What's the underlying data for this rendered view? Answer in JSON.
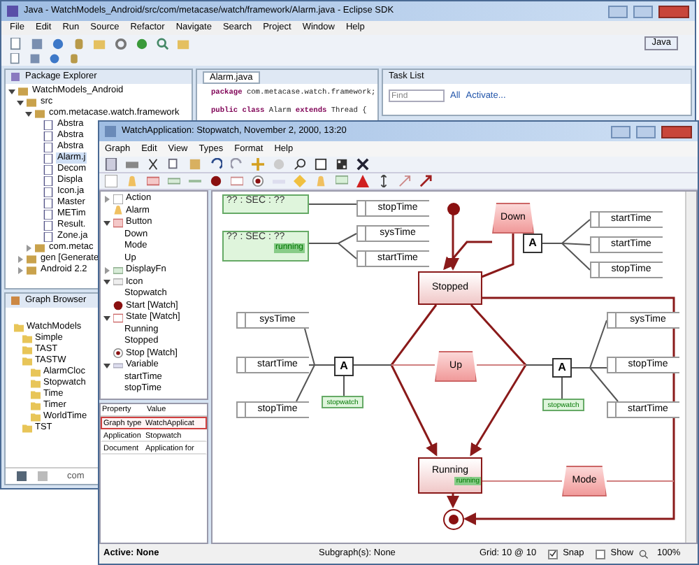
{
  "back_window": {
    "title": "Java - WatchModels_Android/src/com/metacase/watch/framework/Alarm.java - Eclipse SDK",
    "menu": [
      "File",
      "Edit",
      "Run",
      "Source",
      "Refactor",
      "Navigate",
      "Search",
      "Project",
      "Window",
      "Help"
    ],
    "perspective": "Java",
    "package_explorer": {
      "title": "Package Explorer",
      "items": [
        {
          "label": "WatchModels_Android",
          "expanded": true,
          "children": [
            {
              "label": "src",
              "expanded": true,
              "children": [
                {
                  "label": "com.metacase.watch.framework",
                  "expanded": true,
                  "children": [
                    {
                      "label": "Abstra"
                    },
                    {
                      "label": "Abstra"
                    },
                    {
                      "label": "Abstra"
                    },
                    {
                      "label": "Alarm.j",
                      "selected": true
                    },
                    {
                      "label": "Decom"
                    },
                    {
                      "label": "Displa"
                    },
                    {
                      "label": "Icon.ja"
                    },
                    {
                      "label": "Master"
                    },
                    {
                      "label": "METim"
                    },
                    {
                      "label": "Result."
                    },
                    {
                      "label": "Zone.ja"
                    }
                  ]
                },
                {
                  "label": "com.metac",
                  "expanded": false
                }
              ]
            },
            {
              "label": "gen [Generate",
              "expanded": false
            },
            {
              "label": "Android 2.2",
              "expanded": false
            }
          ]
        }
      ]
    },
    "editor": {
      "tab": "Alarm.java",
      "lines": [
        [
          {
            "kind": "keyword",
            "text": "package"
          },
          {
            "kind": "plain",
            "text": " com.metacase.watch.framework;"
          }
        ],
        [
          {
            "kind": "keyword",
            "text": "public class"
          },
          {
            "kind": "plain",
            "text": " Alarm "
          },
          {
            "kind": "keyword",
            "text": "extends"
          },
          {
            "kind": "plain",
            "text": " Thread {"
          }
        ]
      ]
    },
    "task_list": {
      "title": "Task List",
      "find_placeholder": "Find",
      "filters": [
        "All",
        "Activate..."
      ]
    },
    "graph_browser": {
      "title": "Graph Browser",
      "items": [
        {
          "label": "WatchModels",
          "children": [
            {
              "label": "Simple"
            },
            {
              "label": "TAST"
            },
            {
              "label": "TASTW",
              "children": [
                {
                  "label": "AlarmCloc"
                },
                {
                  "label": "Stopwatch"
                },
                {
                  "label": "Time"
                },
                {
                  "label": "Timer"
                },
                {
                  "label": "WorldTime"
                }
              ]
            },
            {
              "label": "TST"
            }
          ]
        }
      ],
      "status": "com"
    }
  },
  "front_window": {
    "title": "WatchApplication: Stopwatch, November 2, 2000, 13:20",
    "menu": [
      "Graph",
      "Edit",
      "View",
      "Types",
      "Format",
      "Help"
    ],
    "palette": [
      {
        "label": "Action",
        "expanded": false
      },
      {
        "label": "Alarm"
      },
      {
        "label": "Button",
        "expanded": true,
        "children": [
          {
            "label": "Down"
          },
          {
            "label": "Mode"
          },
          {
            "label": "Up"
          }
        ]
      },
      {
        "label": "DisplayFn",
        "expanded": false
      },
      {
        "label": "Icon",
        "expanded": true,
        "children": [
          {
            "label": "Stopwatch"
          }
        ]
      },
      {
        "label": "Start [Watch]"
      },
      {
        "label": "State [Watch]",
        "expanded": true,
        "children": [
          {
            "label": "Running"
          },
          {
            "label": "Stopped"
          }
        ]
      },
      {
        "label": "Stop [Watch]"
      },
      {
        "label": "Variable",
        "expanded": true,
        "children": [
          {
            "label": "startTime"
          },
          {
            "label": "stopTime"
          }
        ]
      }
    ],
    "properties": {
      "columns": [
        "Property",
        "Value"
      ],
      "rows": [
        {
          "property": "Graph type",
          "value": "WatchApplicat",
          "selected": true
        },
        {
          "property": "Application",
          "value": "Stopwatch",
          "selected": false
        },
        {
          "property": "Document",
          "value": "Application for",
          "selected": false
        }
      ]
    },
    "diagram": [
      {
        "kind": "condition",
        "text": "?? : SEC : ??"
      },
      {
        "kind": "condition",
        "text": "?? : SEC : ??",
        "sub": "running"
      },
      {
        "kind": "variable",
        "text": "stopTime"
      },
      {
        "kind": "variable",
        "text": "sysTime"
      },
      {
        "kind": "variable",
        "text": "startTime"
      },
      {
        "kind": "state",
        "text": "Stopped"
      },
      {
        "kind": "start"
      },
      {
        "kind": "button",
        "text": "Down"
      },
      {
        "kind": "action",
        "text": "A"
      },
      {
        "kind": "variable",
        "text": "startTime"
      },
      {
        "kind": "variable",
        "text": "startTime"
      },
      {
        "kind": "variable",
        "text": "stopTime"
      },
      {
        "kind": "variable",
        "text": "sysTime"
      },
      {
        "kind": "variable",
        "text": "startTime"
      },
      {
        "kind": "variable",
        "text": "stopTime"
      },
      {
        "kind": "action",
        "text": "A"
      },
      {
        "kind": "icon",
        "text": "stopwatch"
      },
      {
        "kind": "button",
        "text": "Up"
      },
      {
        "kind": "action",
        "text": "A"
      },
      {
        "kind": "icon",
        "text": "stopwatch"
      },
      {
        "kind": "variable",
        "text": "sysTime"
      },
      {
        "kind": "variable",
        "text": "stopTime"
      },
      {
        "kind": "variable",
        "text": "startTime"
      },
      {
        "kind": "state",
        "text": "Running",
        "sub": "running"
      },
      {
        "kind": "button",
        "text": "Mode"
      },
      {
        "kind": "stop"
      }
    ],
    "status": {
      "active": "Active: None",
      "subgraphs": "Subgraph(s): None",
      "grid": "Grid: 10 @ 10",
      "snap_label": "Snap",
      "snap": true,
      "show_label": "Show",
      "show": false,
      "zoom": "100%"
    }
  }
}
